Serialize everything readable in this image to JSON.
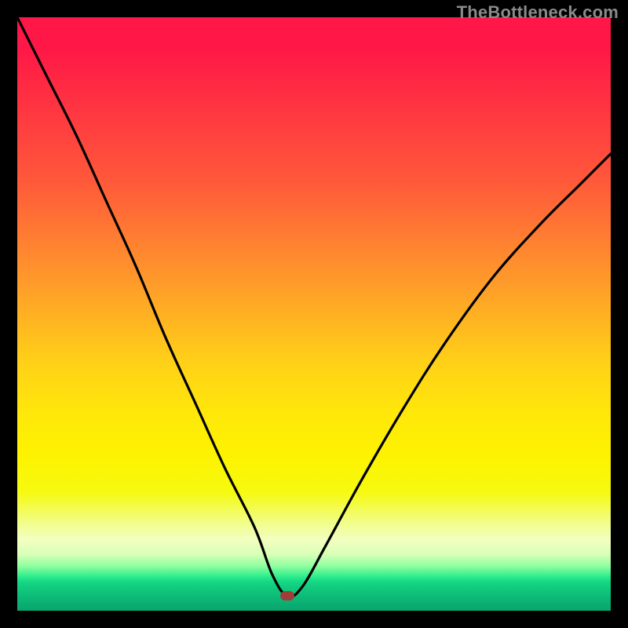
{
  "watermark": "TheBottleneck.com",
  "colors": {
    "frame": "#000000",
    "curve": "#000000",
    "marker": "#9c3f3a"
  },
  "chart_data": {
    "type": "line",
    "title": "",
    "xlabel": "",
    "ylabel": "",
    "xlim": [
      0,
      100
    ],
    "ylim": [
      0,
      100
    ],
    "grid": false,
    "legend": false,
    "minimum": {
      "x": 45.5,
      "y": 2.5
    },
    "series": [
      {
        "name": "bottleneck-curve",
        "x": [
          0,
          5,
          10,
          15,
          20,
          25,
          30,
          35,
          40,
          43,
          45.5,
          48,
          52,
          58,
          65,
          72,
          80,
          88,
          95,
          100
        ],
        "values": [
          100,
          90,
          80,
          69,
          58,
          46,
          35,
          24,
          14,
          6,
          2.5,
          4,
          11,
          22,
          34,
          45,
          56,
          65,
          72,
          77
        ]
      }
    ]
  }
}
